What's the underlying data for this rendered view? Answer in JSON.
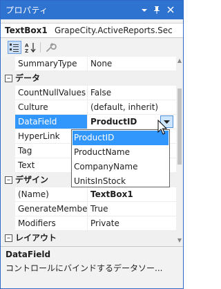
{
  "window": {
    "title": "プロパティ",
    "controls": {
      "dropdown": "▾",
      "pin": "ᅟ",
      "close": "✕"
    }
  },
  "object_selector": {
    "name": "TextBox1",
    "type": "GrapeCity.ActiveReports.Sec"
  },
  "toolbar": {
    "buttons": [
      {
        "name": "categorized",
        "icon": "categorized-icon",
        "active": true
      },
      {
        "name": "alphabetical",
        "icon": "alphabetical-icon",
        "active": false
      },
      {
        "name": "property-pages",
        "icon": "wrench-icon",
        "active": false
      }
    ]
  },
  "grid": {
    "rows": [
      {
        "kind": "prop",
        "name": "SummaryType",
        "value": "None"
      },
      {
        "kind": "cat",
        "expander": "⊟",
        "label": "データ"
      },
      {
        "kind": "prop",
        "name": "CountNullValues",
        "value": "False"
      },
      {
        "kind": "prop",
        "name": "Culture",
        "value": "(default, inherit)"
      },
      {
        "kind": "prop",
        "name": "DataField",
        "value": "ProductID",
        "selected": true,
        "bold": true
      },
      {
        "kind": "prop",
        "name": "HyperLink",
        "value": ""
      },
      {
        "kind": "prop",
        "name": "Tag",
        "value": ""
      },
      {
        "kind": "prop",
        "name": "Text",
        "value": ""
      },
      {
        "kind": "cat",
        "expander": "⊟",
        "label": "デザイン"
      },
      {
        "kind": "prop",
        "name": "(Name)",
        "value": "TextBox1",
        "bold": true
      },
      {
        "kind": "prop",
        "name": "GenerateMember",
        "value": "True"
      },
      {
        "kind": "prop",
        "name": "Modifiers",
        "value": "Private"
      },
      {
        "kind": "cat",
        "expander": "⊟",
        "label": "レイアウト"
      }
    ]
  },
  "dropdown": {
    "options": [
      "ProductID",
      "ProductName",
      "CompanyName",
      "UnitsInStock"
    ],
    "highlighted_index": 0
  },
  "description": {
    "title": "DataField",
    "text": "コントロールにバインドするデータソー..."
  },
  "colors": {
    "titlebar": "#2f73d1",
    "selection": "#3297fd",
    "category_background": "#f0f0f0"
  }
}
